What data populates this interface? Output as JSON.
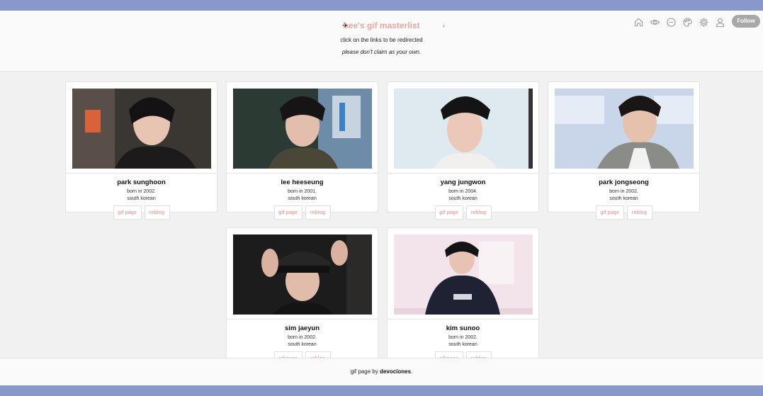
{
  "header": {
    "star_glyph": "✦",
    "title": "bee's gif masterlist",
    "comma": ",",
    "subtitle": "click on the links to be redirected",
    "subtitle2": "please don't claim as your own.",
    "follow_label": "Follow",
    "nav_icons": [
      "home-icon",
      "eye-icon",
      "minus-circle-icon",
      "palette-icon",
      "gear-icon",
      "user-icon"
    ]
  },
  "cards": [
    {
      "name": "park sunghoon",
      "born": "born in 2002.",
      "nationality": "south korean",
      "gif_label": "gif page",
      "reblog_label": "reblog"
    },
    {
      "name": "lee heeseung",
      "born": "born in 2001.",
      "nationality": "south korean",
      "gif_label": "gif page",
      "reblog_label": "reblog"
    },
    {
      "name": "yang jungwon",
      "born": "born in 2004.",
      "nationality": "south korean",
      "gif_label": "gif page",
      "reblog_label": "reblog"
    },
    {
      "name": "park jongseong",
      "born": "born in 2002.",
      "nationality": "south korean",
      "gif_label": "gif page",
      "reblog_label": "reblog"
    },
    {
      "name": "sim jaeyun",
      "born": "born in 2002.",
      "nationality": "south korean",
      "gif_label": "gif page",
      "reblog_label": "reblog"
    },
    {
      "name": "kim sunoo",
      "born": "born in 2002.",
      "nationality": "south korean",
      "gif_label": "gif page",
      "reblog_label": "reblog"
    }
  ],
  "footer": {
    "prefix": "gif page by",
    "author": "devociones",
    "suffix": "."
  },
  "colors": {
    "stripe": "#8898c8",
    "accent": "#e8a8a0",
    "follow_bg": "#a8a8a8"
  }
}
